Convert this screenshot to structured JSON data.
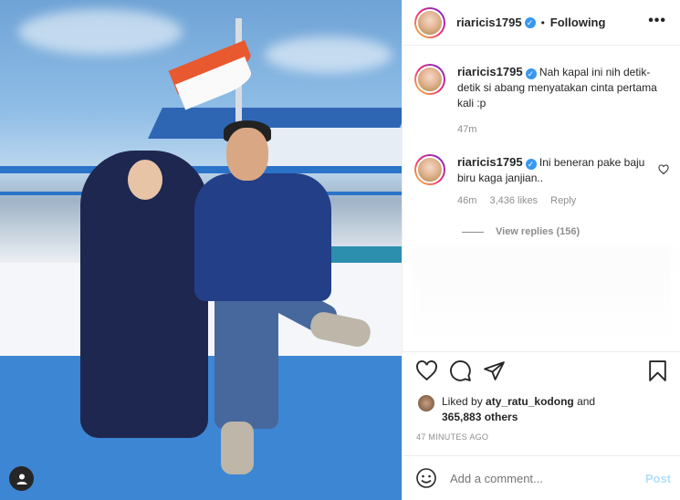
{
  "post": {
    "username": "riaricis1795",
    "verified": true,
    "follow_status": "Following",
    "separator": "•",
    "more_label": "•••"
  },
  "caption": {
    "username": "riaricis1795",
    "text": "Nah kapal ini nih detik-detik si abang menyatakan cinta pertama kali :p",
    "time": "47m"
  },
  "comments": [
    {
      "username": "riaricis1795",
      "text": "Ini beneran pake baju biru kaga janjian..",
      "time": "46m",
      "likes": "3,436 likes",
      "reply_label": "Reply",
      "view_replies": "View replies (156)"
    }
  ],
  "likes": {
    "prefix": "Liked by",
    "user": "aty_ratu_kodong",
    "joiner": "and",
    "others": "365,883 others"
  },
  "timestamp": "47 MINUTES AGO",
  "add_comment": {
    "placeholder": "Add a comment...",
    "post_label": "Post"
  },
  "icons": [
    "heart-icon",
    "comment-icon",
    "share-icon",
    "bookmark-icon",
    "emoji-icon",
    "user-tag-icon",
    "more-icon",
    "verified-badge-icon"
  ],
  "colors": {
    "verified": "#3897f0",
    "post_button": "#b2dffc",
    "muted_text": "#8e8e8e"
  }
}
